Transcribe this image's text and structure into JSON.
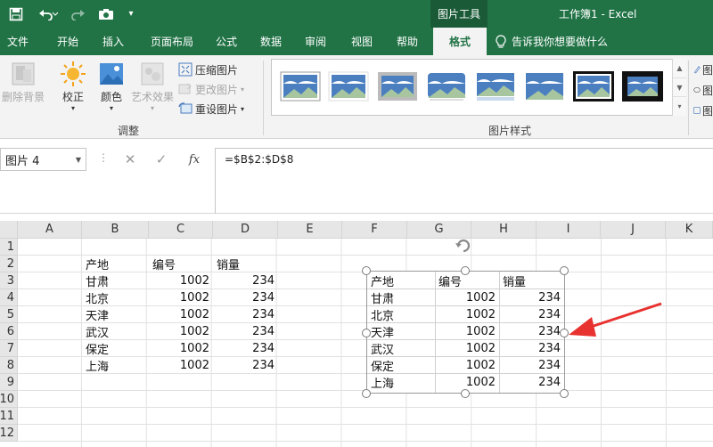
{
  "app": {
    "context_tab_header": "图片工具",
    "window_title": "工作簿1  -  Excel"
  },
  "tabs": [
    "文件",
    "开始",
    "插入",
    "页面布局",
    "公式",
    "数据",
    "审阅",
    "视图",
    "帮助",
    "格式"
  ],
  "active_tab_index": 9,
  "tell_me": {
    "label": "告诉我你想要做什么",
    "icon": "lightbulb-icon"
  },
  "ribbon": {
    "adjust": {
      "remove_bg": "删除背景",
      "corrections": "校正",
      "color": "颜色",
      "artistic": "艺术效果",
      "compress": "压缩图片",
      "change": "更改图片",
      "reset": "重设图片",
      "group_label": "调整"
    },
    "styles": {
      "group_label": "图片样式",
      "thumb_count": 8
    },
    "right_items": [
      "图",
      "图",
      "图"
    ]
  },
  "formula_bar": {
    "name_box": "图片 4",
    "cancel": "✕",
    "enter": "✓",
    "fx": "fx",
    "formula": "=$B$2:$D$8"
  },
  "sheet": {
    "columns": [
      "A",
      "B",
      "C",
      "D",
      "E",
      "F",
      "G",
      "H",
      "I",
      "J",
      "K"
    ],
    "rows": [
      "1",
      "2",
      "3",
      "4",
      "5",
      "6",
      "7",
      "8",
      "9",
      "10",
      "11",
      "12"
    ],
    "table": {
      "headers": [
        "产地",
        "编号",
        "销量"
      ],
      "rows": [
        [
          "甘肃",
          "1002",
          "234"
        ],
        [
          "北京",
          "1002",
          "234"
        ],
        [
          "天津",
          "1002",
          "234"
        ],
        [
          "武汉",
          "1002",
          "234"
        ],
        [
          "保定",
          "1002",
          "234"
        ],
        [
          "上海",
          "1002",
          "234"
        ]
      ]
    }
  },
  "colors": {
    "excel_green": "#217346",
    "arrow_red": "#e8322f"
  }
}
